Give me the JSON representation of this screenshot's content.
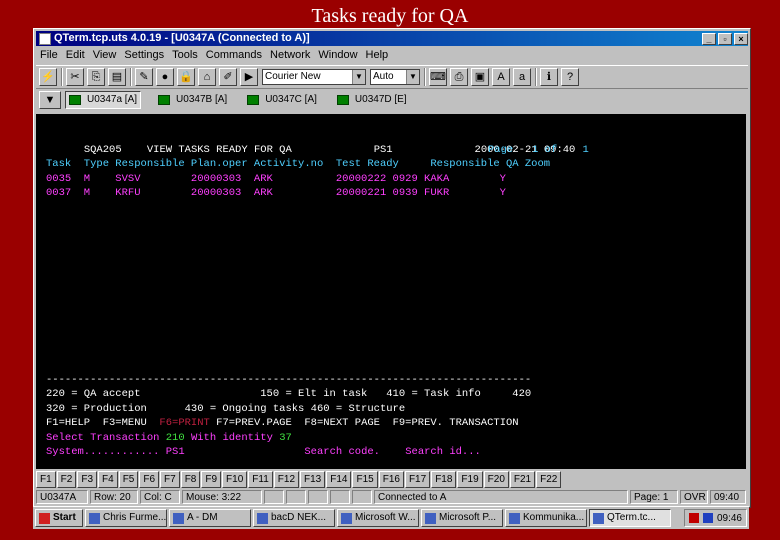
{
  "slide": {
    "title": "Tasks ready for QA"
  },
  "window": {
    "title": "QTerm.tcp.uts 4.0.19 - [U0347A (Connected to A)]",
    "controls": [
      "_",
      "▫",
      "×"
    ]
  },
  "menu": [
    "File",
    "Edit",
    "View",
    "Settings",
    "Tools",
    "Commands",
    "Network",
    "Window",
    "Help"
  ],
  "toolbar": {
    "font_select": "Courier New",
    "size_select": "Auto"
  },
  "sessions": [
    "U0347a [A]",
    "U0347B [A]",
    "U0347C [A]",
    "U0347D [E]"
  ],
  "screen": {
    "screen_id": "SQA205",
    "heading": "VIEW TASKS READY FOR QA",
    "system": "PS1",
    "datetime": "2000-02-21 09:40",
    "page_line": "Page   1 of    1",
    "columns_line": "Task  Type Responsible Plan.oper Activity.no  Test Ready     Responsible QA Zoom",
    "rows": [
      "0035  M    SVSV        20000303  ARK          20000222 0929 KAKA        Y",
      "0037  M    KRFU        20000303  ARK          20000221 0939 FUKR        Y"
    ],
    "separator": "-----------------------------------------------------------------------------",
    "legend1": "220 = QA accept                   150 = Elt in task   410 = Task info     420",
    "legend2": "320 = Production      430 = Ongoing tasks 460 = Structure",
    "keys_a": "F1=HELP  F3=MENU  ",
    "keys_f6": "F6=PRINT",
    "keys_b": " F7=PREV.PAGE  F8=NEXT PAGE  F9=PREV. TRANSACTION",
    "select_label": "Select Transaction",
    "select_value": "210",
    "identity_label": "With identity",
    "identity_value": "37",
    "system_label": "System............",
    "system_value": "PS1",
    "search_code": "Search code.",
    "search_id": "Search id..."
  },
  "fkeys": [
    "F1",
    "F2",
    "F3",
    "F4",
    "F5",
    "F6",
    "F7",
    "F8",
    "F9",
    "F10",
    "F11",
    "F12",
    "F13",
    "F14",
    "F15",
    "F16",
    "F17",
    "F18",
    "F19",
    "F20",
    "F21",
    "F22"
  ],
  "status": {
    "session": "U0347A",
    "row": "Row: 20",
    "col": "Col: C",
    "mouse": "Mouse: 3:22",
    "connection": "Connected to A",
    "page": "Page: 1",
    "ovr": "OVR",
    "time": "09:40"
  },
  "taskbar": {
    "start": "Start",
    "tasks": [
      "Chris Furme...",
      "A - DM",
      "bacD NEK...",
      "Microsoft W...",
      "Microsoft P...",
      "Kommunika...",
      "QTerm.tc..."
    ],
    "active_task_index": 6,
    "clock": "09:46"
  }
}
